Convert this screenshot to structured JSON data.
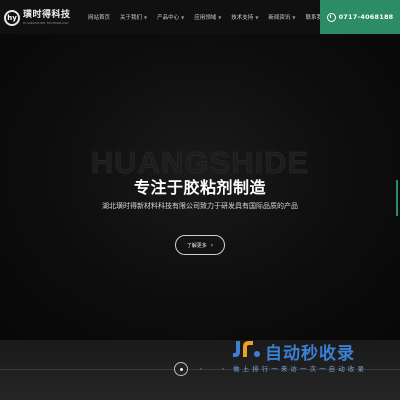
{
  "header": {
    "logo_mark": "hy",
    "brand_cn": "璜时得科技",
    "brand_en": "HUANGSHIDE TECHNOLOGY",
    "nav": [
      {
        "label": "网站首页",
        "dropdown": false
      },
      {
        "label": "关于我们",
        "dropdown": true
      },
      {
        "label": "产品中心",
        "dropdown": true
      },
      {
        "label": "应用领域",
        "dropdown": true
      },
      {
        "label": "技术支持",
        "dropdown": true
      },
      {
        "label": "新闻资讯",
        "dropdown": true
      },
      {
        "label": "联系我们",
        "dropdown": true
      }
    ],
    "phone": "0717-4068188"
  },
  "hero": {
    "ghost_word": "HUANGSHIDE",
    "headline": "专注于胶粘剂制造",
    "subline": "湖北璜时得新材料科技有限公司致力于研发具有国际品质的产品",
    "cta_label": "了解更多",
    "cta_arrow": "›"
  },
  "watermark": {
    "title": "自动秒收录",
    "subtitle": "做 上 排 行 一 来 访 一 次 一 自 动 收 录"
  },
  "colors": {
    "accent_green": "#2b8c66",
    "watermark_blue": "#3b7fd6"
  }
}
